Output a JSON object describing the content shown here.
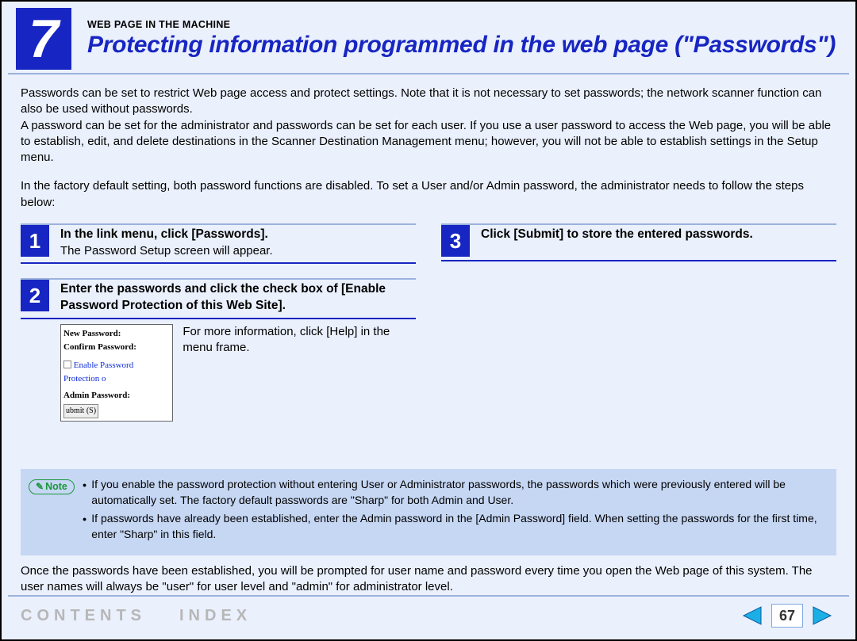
{
  "header": {
    "chapter_number": "7",
    "eyebrow": "WEB PAGE IN THE MACHINE",
    "title": "Protecting information programmed in the web page (\"Passwords\")"
  },
  "intro": {
    "p1": "Passwords can be set to restrict Web page access and protect settings. Note that it is not necessary to set passwords; the network scanner function can also be used without passwords.",
    "p2": "A password can be set for the administrator and passwords can be set for each user. If you use a user password to access the Web page, you will be able to establish, edit, and delete destinations in the Scanner Destination Management menu; however, you will not be able to establish settings in the Setup menu.",
    "p3": "In the factory default setting, both password functions are disabled. To set a User and/or Admin password, the administrator needs to follow the steps below:"
  },
  "steps": [
    {
      "num": "1",
      "title": "In the link menu, click [Passwords].",
      "text": "The Password Setup screen will appear."
    },
    {
      "num": "2",
      "title": "Enter the passwords and click the check box of [Enable Password Protection of this Web Site].",
      "text": "For more information, click [Help] in the menu frame.",
      "screenshot": {
        "line1": "New Password:",
        "line2": "Confirm Password:",
        "checkbox": "Enable Password Protection o",
        "line3": "Admin Password:",
        "button": "ubmit (S)"
      }
    },
    {
      "num": "3",
      "title": "Click [Submit] to store the entered passwords."
    }
  ],
  "note": {
    "label": "Note",
    "bullets": [
      "If you enable the password protection without entering User or Administrator passwords, the passwords which were previously entered will be automatically set. The factory default passwords are \"Sharp\" for both Admin and User.",
      "If passwords have already been established, enter the Admin password in the [Admin Password] field. When setting the passwords for the first time, enter \"Sharp\" in this field."
    ]
  },
  "closing": "Once the passwords have been established, you will be prompted for user name and password every time you open the Web page of this system. The user names will always be \"user\" for user level and \"admin\" for administrator level.",
  "footer": {
    "contents": "CONTENTS",
    "index": "INDEX",
    "page_number": "67"
  }
}
